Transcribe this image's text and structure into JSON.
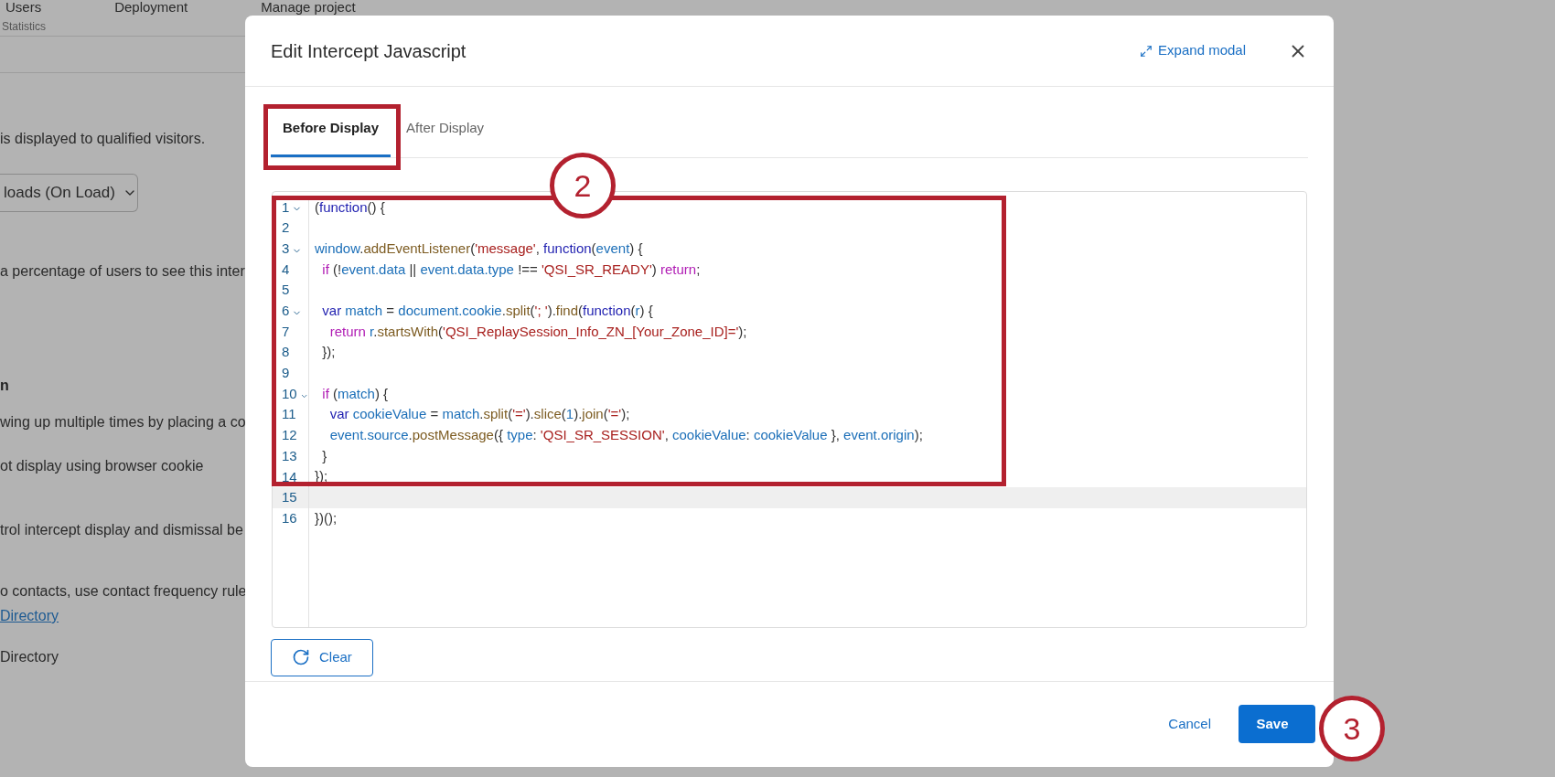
{
  "background": {
    "nav": [
      "Users",
      "Deployment",
      "Manage project"
    ],
    "subnav": "Statistics",
    "texts": [
      {
        "kind": "text",
        "text": "is displayed to qualified visitors."
      },
      {
        "kind": "dropdown",
        "text": "loads (On Load)"
      },
      {
        "kind": "text",
        "text": "a percentage of users to see this inter"
      },
      {
        "kind": "heading",
        "text": "n"
      },
      {
        "kind": "text",
        "text": "wing up multiple times by placing a co"
      },
      {
        "kind": "text",
        "text": "ot display using browser cookie"
      },
      {
        "kind": "text",
        "text": "trol intercept display and dismissal be"
      },
      {
        "kind": "text",
        "text": "o contacts, use contact frequency rule"
      },
      {
        "kind": "link",
        "text": "Directory"
      },
      {
        "kind": "text",
        "text": "Directory"
      }
    ]
  },
  "modal": {
    "title": "Edit Intercept Javascript",
    "expand": "Expand modal",
    "tabs": [
      {
        "label": "Before Display",
        "selected": true
      },
      {
        "label": "After Display",
        "selected": false
      }
    ],
    "code": [
      {
        "number": "1",
        "foldable": true,
        "highlighted": false,
        "tokens": [
          {
            "kind": "punct",
            "text": "("
          },
          {
            "kind": "keyword",
            "text": "function"
          },
          {
            "kind": "punct",
            "text": "() {"
          }
        ]
      },
      {
        "number": "2",
        "foldable": false,
        "highlighted": false
      },
      {
        "number": "3",
        "foldable": true,
        "highlighted": false,
        "tokens": [
          {
            "kind": "variable",
            "text": "window"
          },
          {
            "kind": "punct",
            "text": "."
          },
          {
            "kind": "method",
            "text": "addEventListener"
          },
          {
            "kind": "punct",
            "text": "("
          },
          {
            "kind": "string",
            "text": "'message'"
          },
          {
            "kind": "punct",
            "text": ", "
          },
          {
            "kind": "keyword",
            "text": "function"
          },
          {
            "kind": "punct",
            "text": "("
          },
          {
            "kind": "variable",
            "text": "event"
          },
          {
            "kind": "punct",
            "text": ") {"
          }
        ]
      },
      {
        "number": "4",
        "foldable": false,
        "highlighted": false,
        "tokens": [
          {
            "kind": "control",
            "text": "  if"
          },
          {
            "kind": "punct",
            "text": " (!"
          },
          {
            "kind": "variable",
            "text": "event.data"
          },
          {
            "kind": "punct",
            "text": " || "
          },
          {
            "kind": "variable",
            "text": "event.data.type"
          },
          {
            "kind": "punct",
            "text": " !== "
          },
          {
            "kind": "string",
            "text": "'QSI_SR_READY'"
          },
          {
            "kind": "punct",
            "text": ") "
          },
          {
            "kind": "control",
            "text": "return"
          },
          {
            "kind": "punct",
            "text": ";"
          }
        ]
      },
      {
        "number": "5",
        "foldable": false,
        "highlighted": false
      },
      {
        "number": "6",
        "foldable": true,
        "highlighted": false,
        "tokens": [
          {
            "kind": "keyword",
            "text": "  var"
          },
          {
            "kind": "variable",
            "text": " match"
          },
          {
            "kind": "punct",
            "text": " = "
          },
          {
            "kind": "variable",
            "text": "document.cookie"
          },
          {
            "kind": "punct",
            "text": "."
          },
          {
            "kind": "method",
            "text": "split"
          },
          {
            "kind": "punct",
            "text": "("
          },
          {
            "kind": "string",
            "text": "'; '"
          },
          {
            "kind": "punct",
            "text": ")."
          },
          {
            "kind": "method",
            "text": "find"
          },
          {
            "kind": "punct",
            "text": "("
          },
          {
            "kind": "keyword",
            "text": "function"
          },
          {
            "kind": "punct",
            "text": "("
          },
          {
            "kind": "variable",
            "text": "r"
          },
          {
            "kind": "punct",
            "text": ") {"
          }
        ]
      },
      {
        "number": "7",
        "foldable": false,
        "highlighted": false,
        "tokens": [
          {
            "kind": "control",
            "text": "    return"
          },
          {
            "kind": "variable",
            "text": " r"
          },
          {
            "kind": "punct",
            "text": "."
          },
          {
            "kind": "method",
            "text": "startsWith"
          },
          {
            "kind": "punct",
            "text": "("
          },
          {
            "kind": "string",
            "text": "'QSI_ReplaySession_Info_ZN_[Your_Zone_ID]='"
          },
          {
            "kind": "punct",
            "text": ");"
          }
        ]
      },
      {
        "number": "8",
        "foldable": false,
        "highlighted": false,
        "tokens": [
          {
            "kind": "punct",
            "text": "  });"
          }
        ]
      },
      {
        "number": "9",
        "foldable": false,
        "highlighted": false
      },
      {
        "number": "10",
        "foldable": true,
        "highlighted": false,
        "tokens": [
          {
            "kind": "control",
            "text": "  if"
          },
          {
            "kind": "punct",
            "text": " ("
          },
          {
            "kind": "variable",
            "text": "match"
          },
          {
            "kind": "punct",
            "text": ") {"
          }
        ]
      },
      {
        "number": "11",
        "foldable": false,
        "highlighted": false,
        "tokens": [
          {
            "kind": "keyword",
            "text": "    var"
          },
          {
            "kind": "variable",
            "text": " cookieValue"
          },
          {
            "kind": "punct",
            "text": " = "
          },
          {
            "kind": "variable",
            "text": "match"
          },
          {
            "kind": "punct",
            "text": "."
          },
          {
            "kind": "method",
            "text": "split"
          },
          {
            "kind": "punct",
            "text": "("
          },
          {
            "kind": "string",
            "text": "'='"
          },
          {
            "kind": "punct",
            "text": ")."
          },
          {
            "kind": "method",
            "text": "slice"
          },
          {
            "kind": "punct",
            "text": "("
          },
          {
            "kind": "number",
            "text": "1"
          },
          {
            "kind": "punct",
            "text": ")."
          },
          {
            "kind": "method",
            "text": "join"
          },
          {
            "kind": "punct",
            "text": "("
          },
          {
            "kind": "string",
            "text": "'='"
          },
          {
            "kind": "punct",
            "text": ");"
          }
        ]
      },
      {
        "number": "12",
        "foldable": false,
        "highlighted": false,
        "tokens": [
          {
            "kind": "variable",
            "text": "    event.source"
          },
          {
            "kind": "punct",
            "text": "."
          },
          {
            "kind": "method",
            "text": "postMessage"
          },
          {
            "kind": "punct",
            "text": "({ "
          },
          {
            "kind": "variable",
            "text": "type"
          },
          {
            "kind": "punct",
            "text": ": "
          },
          {
            "kind": "string",
            "text": "'QSI_SR_SESSION'"
          },
          {
            "kind": "punct",
            "text": ", "
          },
          {
            "kind": "variable",
            "text": "cookieValue"
          },
          {
            "kind": "punct",
            "text": ": "
          },
          {
            "kind": "variable",
            "text": "cookieValue"
          },
          {
            "kind": "punct",
            "text": " }, "
          },
          {
            "kind": "variable",
            "text": "event.origin"
          },
          {
            "kind": "punct",
            "text": ");"
          }
        ]
      },
      {
        "number": "13",
        "foldable": false,
        "highlighted": false,
        "tokens": [
          {
            "kind": "punct",
            "text": "  }"
          }
        ]
      },
      {
        "number": "14",
        "foldable": false,
        "highlighted": false,
        "tokens": [
          {
            "kind": "punct",
            "text": "});"
          }
        ]
      },
      {
        "number": "15",
        "foldable": false,
        "highlighted": true
      },
      {
        "number": "16",
        "foldable": false,
        "highlighted": false,
        "tokens": [
          {
            "kind": "punct",
            "text": "})();"
          }
        ]
      }
    ],
    "clear": "Clear",
    "cancel": "Cancel",
    "save": "Save"
  },
  "annotations": [
    {
      "kind": "tab_frame"
    },
    {
      "kind": "code_frame"
    },
    {
      "kind": "step",
      "text": "2"
    },
    {
      "kind": "step",
      "text": "3"
    }
  ]
}
